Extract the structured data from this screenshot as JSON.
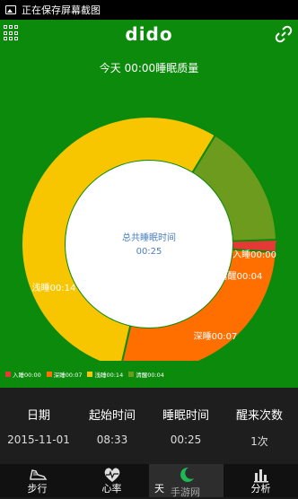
{
  "status_bar": {
    "text": "正在保存屏幕截图"
  },
  "header": {
    "title": "dido"
  },
  "subtitle": "今天 00:00睡眠质量",
  "center": {
    "label": "总共睡眠时间",
    "value": "00:25"
  },
  "segments": [
    {
      "name": "入睡",
      "time": "00:00",
      "label": "入睡00:00",
      "color": "#e53935",
      "value": 0.4
    },
    {
      "name": "深睡",
      "time": "00:07",
      "label": "深睡00:07",
      "color": "#ff6f00",
      "value": 7
    },
    {
      "name": "浅睡",
      "time": "00:14",
      "label": "浅睡00:14",
      "color": "#f7c600",
      "value": 14
    },
    {
      "name": "清醒",
      "time": "00:04",
      "label": "清醒00:04",
      "color": "#6c9b1e",
      "value": 4
    }
  ],
  "legend": [
    {
      "label": "入睡00:00",
      "color": "#e53935"
    },
    {
      "label": "深睡00:07",
      "color": "#ff6f00"
    },
    {
      "label": "浅睡00:14",
      "color": "#f7c600"
    },
    {
      "label": "清醒00:04",
      "color": "#6c9b1e"
    }
  ],
  "stats": {
    "date": {
      "label": "日期",
      "value": "2015-11-01"
    },
    "start": {
      "label": "起始时间",
      "value": "08:33"
    },
    "sleep": {
      "label": "睡眠时间",
      "value": "00:25"
    },
    "wake": {
      "label": "醒来次数",
      "value": "1次"
    }
  },
  "nav": [
    {
      "label": "步行",
      "icon": "shoe-icon"
    },
    {
      "label": "心率",
      "icon": "heart-icon"
    },
    {
      "label": "天",
      "icon": "moon-icon"
    },
    {
      "label": "分析",
      "icon": "bar-chart-icon"
    }
  ],
  "watermark": "手游网"
}
